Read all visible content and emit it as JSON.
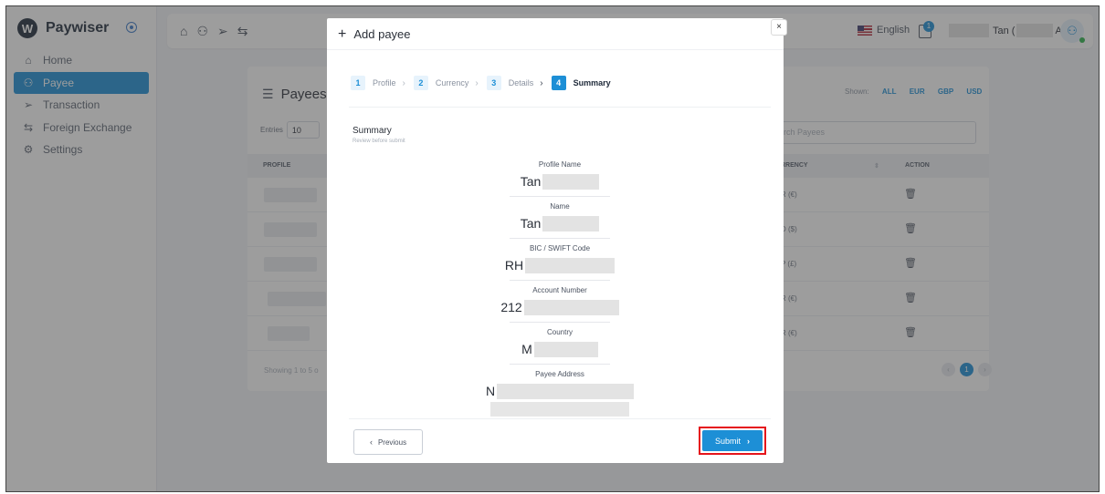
{
  "brand": {
    "name": "Paywiser",
    "logo_letter": "W"
  },
  "sidebar": {
    "items": [
      {
        "label": "Home",
        "icon": "home-icon",
        "glyph": "⌂"
      },
      {
        "label": "Payee",
        "icon": "users-icon",
        "glyph": "⚇"
      },
      {
        "label": "Transaction",
        "icon": "send-icon",
        "glyph": "➢"
      },
      {
        "label": "Foreign Exchange",
        "icon": "exchange-icon",
        "glyph": "⇆"
      },
      {
        "label": "Settings",
        "icon": "gear-icon",
        "glyph": "⚙"
      }
    ]
  },
  "topbar": {
    "language": "English",
    "notification_count": "1",
    "user_name_prefix": "Tan (",
    "user_name_suffix": "AN)"
  },
  "payees_card": {
    "title": "Payees",
    "shown_label": "Shown:",
    "filters": [
      "ALL",
      "EUR",
      "GBP",
      "USD"
    ],
    "entries_label": "Entries",
    "entries_value": "10",
    "search_placeholder": "rch Payees",
    "columns": [
      "PROFILE",
      "RRENCY",
      "ACTION"
    ],
    "rows": [
      {
        "currency": "R (€)"
      },
      {
        "currency": "D ($)"
      },
      {
        "currency": "P (£)"
      },
      {
        "currency": "R (€)"
      },
      {
        "currency": "R (€)"
      }
    ],
    "showing_text": "Showing 1 to 5 o",
    "current_page": "1"
  },
  "modal": {
    "title": "Add payee",
    "close_label": "×",
    "steps": [
      {
        "num": "1",
        "label": "Profile"
      },
      {
        "num": "2",
        "label": "Currency"
      },
      {
        "num": "3",
        "label": "Details"
      },
      {
        "num": "4",
        "label": "Summary"
      }
    ],
    "summary_title": "Summary",
    "summary_subtitle": "Review before submit",
    "fields": [
      {
        "label": "Profile Name",
        "value": "Tan"
      },
      {
        "label": "Name",
        "value": "Tan"
      },
      {
        "label": "BIC / SWIFT Code",
        "value": "RH"
      },
      {
        "label": "Account Number",
        "value": "212"
      },
      {
        "label": "Country",
        "value": "M"
      },
      {
        "label": "Payee Address",
        "value": "N"
      }
    ],
    "previous_label": "Previous",
    "submit_label": "Submit"
  },
  "colors": {
    "accent": "#1d8fd6",
    "highlight": "#e5141b",
    "brand_dark": "#1f2a3a"
  }
}
